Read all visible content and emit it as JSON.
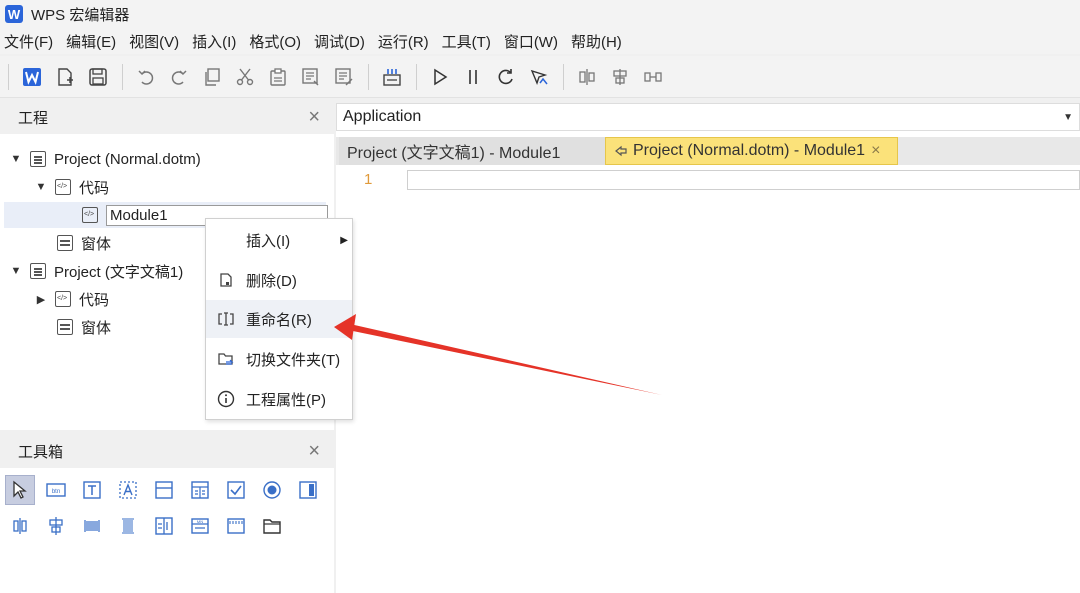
{
  "app": {
    "title": "WPS 宏编辑器",
    "logo": "W"
  },
  "menu": [
    "文件(F)",
    "编辑(E)",
    "视图(V)",
    "插入(I)",
    "格式(O)",
    "调试(D)",
    "运行(R)",
    "工具(T)",
    "窗口(W)",
    "帮助(H)"
  ],
  "project_panel": {
    "title": "工程",
    "close": "×",
    "tree": {
      "project1": "Project (Normal.dotm)",
      "code1": "代码",
      "module1": "Module1",
      "form1": "窗体",
      "project2": "Project (文字文稿1)",
      "code2": "代码",
      "form2": "窗体"
    }
  },
  "context_menu": {
    "insert": "插入(I)",
    "delete": "删除(D)",
    "rename": "重命名(R)",
    "switch_folder": "切换文件夹(T)",
    "properties": "工程属性(P)"
  },
  "toolbox": {
    "title": "工具箱",
    "close": "×"
  },
  "editor": {
    "combo_value": "Application",
    "tabs": [
      "Project (文字文稿1) - Module1",
      "Project (Normal.dotm) - Module1"
    ],
    "active_tab_close": "×",
    "line_number": "1"
  },
  "colors": {
    "accent": "#2b65d9",
    "active_tab": "#fbe27a",
    "arrow": "#e53328",
    "line_number": "#e09a3a"
  }
}
